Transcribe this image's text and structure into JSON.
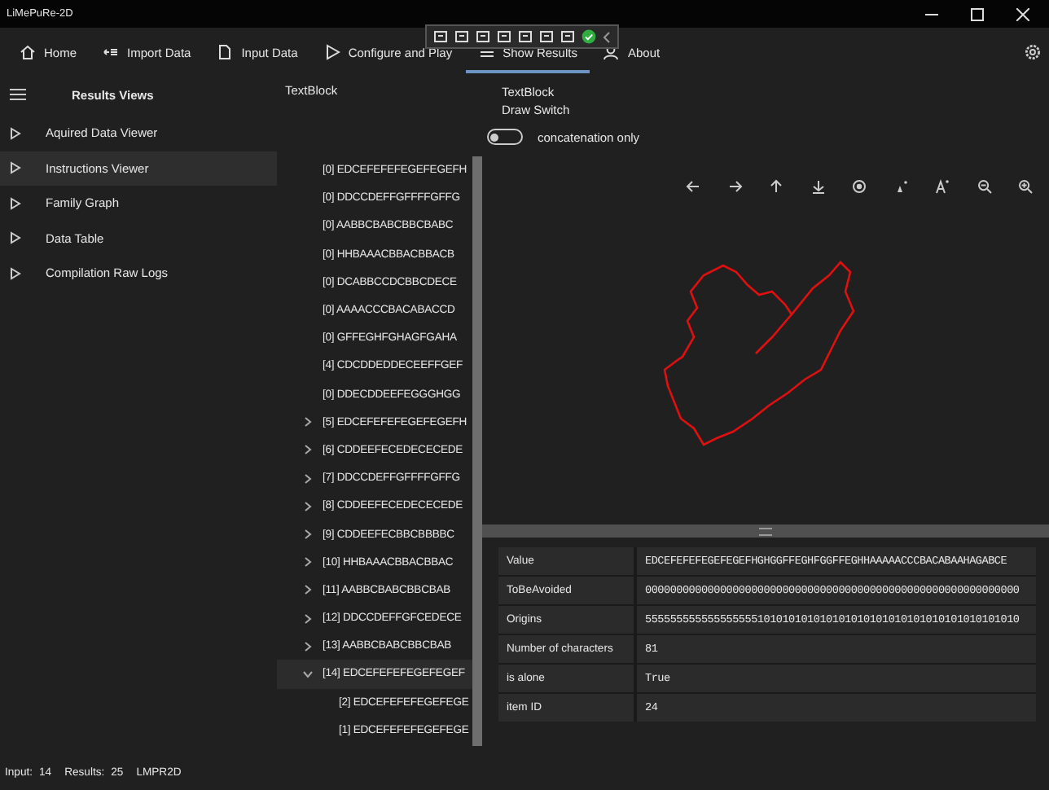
{
  "window": {
    "title": "LiMePuRe-2D"
  },
  "nav": [
    {
      "label": "Home",
      "selected": false
    },
    {
      "label": "Import Data",
      "selected": false
    },
    {
      "label": "Input Data",
      "selected": false
    },
    {
      "label": "Configure and Play",
      "selected": false
    },
    {
      "label": "Show Results",
      "selected": true
    },
    {
      "label": "About",
      "selected": false
    }
  ],
  "sidebar": {
    "title": "Results Views",
    "items": [
      {
        "label": "Aquired Data Viewer",
        "selected": false
      },
      {
        "label": "Instructions Viewer",
        "selected": true
      },
      {
        "label": "Family Graph",
        "selected": false
      },
      {
        "label": "Data Table",
        "selected": false
      },
      {
        "label": "Compilation Raw Logs",
        "selected": false
      }
    ]
  },
  "tree": {
    "header": "TextBlock",
    "items": [
      {
        "label": "[0] EDCEFEFEFEGEFEGEFH",
        "selected": false
      },
      {
        "label": "[0] DDCCDEFFGFFFFGFFG",
        "selected": false
      },
      {
        "label": "[0] AABBCBABCBBCBABC",
        "selected": false
      },
      {
        "label": "[0] HHBAAACBBACBBACB",
        "selected": false
      },
      {
        "label": "[0] DCABBCCDCBBCDECE",
        "selected": false
      },
      {
        "label": "[0] AAAACCCBACABACCD",
        "selected": false
      },
      {
        "label": "[0] GFFEGHFGHAGFGAHA",
        "selected": false
      },
      {
        "label": "[4] CDCDDEDDECEEFFGEF",
        "selected": false
      },
      {
        "label": "[0] DDECDDEEFEGGGHGG",
        "selected": false
      },
      {
        "label": "[5] EDCEFEFEFEGEFEGEFH",
        "expanded": false,
        "selected": false
      },
      {
        "label": "[6] CDDEEFECEDECECEDE",
        "expanded": false,
        "selected": false
      },
      {
        "label": "[7] DDCCDEFFGFFFFGFFG",
        "expanded": false,
        "selected": false
      },
      {
        "label": "[8] CDDEEFECEDECECEDE",
        "expanded": false,
        "selected": false
      },
      {
        "label": "[9] CDDEEFECBBCBBBBC",
        "expanded": false,
        "selected": false
      },
      {
        "label": "[10] HHBAAACBBACBBAC",
        "expanded": false,
        "selected": false
      },
      {
        "label": "[11] AABBCBABCBBCBAB",
        "expanded": false,
        "selected": false
      },
      {
        "label": "[12] DDCCDEFFGFCEDECE",
        "expanded": false,
        "selected": false
      },
      {
        "label": "[13] AABBCBABCBBCBAB",
        "expanded": false,
        "selected": false
      },
      {
        "label": "[14] EDCEFEFEFEGEFEGEF",
        "expanded": true,
        "selected": true,
        "children": [
          {
            "label": "[2] EDCEFEFEFEGEFEGE",
            "selected": false
          },
          {
            "label": "[1] EDCEFEFEFEGEFEGE",
            "selected": false
          }
        ]
      }
    ]
  },
  "draw_panel": {
    "title": "TextBlock",
    "subtitle": "Draw Switch",
    "switch": {
      "label": "concatenation only",
      "on": false
    }
  },
  "properties": [
    {
      "name": "Value",
      "value": "EDCEFEFEFEGEFEGEFHGHGGFFEGHFGGFFEGHHAAAAACCCBACABAAHAGABCE"
    },
    {
      "name": "ToBeAvoided",
      "value": "000000000000000000000000000000000000000000000000000000000000"
    },
    {
      "name": "Origins",
      "value": "555555555555555555101010101010101010101010101010101010101010"
    },
    {
      "name": "Number of characters",
      "value": "81"
    },
    {
      "name": "is alone",
      "value": "True"
    },
    {
      "name": "item ID",
      "value": "24"
    }
  ],
  "status_bar": [
    {
      "label": "Input:",
      "value": "14"
    },
    {
      "label": "Results:",
      "value": "25"
    },
    {
      "label": "LMPR2D"
    }
  ]
}
